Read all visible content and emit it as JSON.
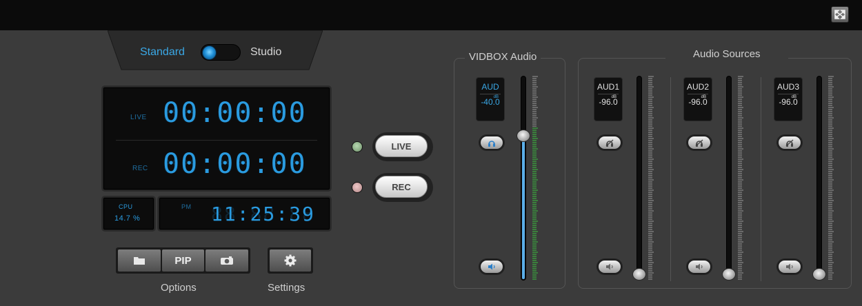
{
  "colors": {
    "accent": "#2a9be0",
    "meter_green": "#38c43c",
    "meter_tick": "#9a9a9a"
  },
  "mode": {
    "left_label": "Standard",
    "right_label": "Studio",
    "selected": "Standard"
  },
  "timers": {
    "live": {
      "label": "LIVE",
      "value": "00:00:00"
    },
    "rec": {
      "label": "REC",
      "value": "00:00:00"
    }
  },
  "cpu": {
    "label": "CPU",
    "value": "14.7 %"
  },
  "clock": {
    "ampm": "PM",
    "time": "11:25:39"
  },
  "options": {
    "buttons": [
      {
        "label": "",
        "icon": "folder-icon"
      },
      {
        "label": "PIP",
        "icon": ""
      },
      {
        "label": "",
        "icon": "camera-icon"
      }
    ],
    "caption": "Options"
  },
  "settings": {
    "icon": "gear-icon",
    "caption": "Settings"
  },
  "broadcast": {
    "live_label": "LIVE",
    "rec_label": "REC",
    "live_led": "#7fa87a",
    "rec_led": "#c99a9a"
  },
  "vidbox_audio": {
    "title": "VIDBOX Audio",
    "channel": {
      "name": "AUD",
      "unit": "dB",
      "value": "-40.0",
      "level_fraction": 0.72,
      "monitor_icon": "headphones-icon",
      "speaker_icon": "speaker-icon"
    }
  },
  "audio_sources": {
    "title": "Audio Sources",
    "channels": [
      {
        "name": "AUD1",
        "unit": "dB",
        "value": "-96.0",
        "level_fraction": 0.0,
        "monitor_icon": "headphones-muted-icon",
        "speaker_icon": "speaker-icon"
      },
      {
        "name": "AUD2",
        "unit": "dB",
        "value": "-96.0",
        "level_fraction": 0.0,
        "monitor_icon": "headphones-muted-icon",
        "speaker_icon": "speaker-icon"
      },
      {
        "name": "AUD3",
        "unit": "dB",
        "value": "-96.0",
        "level_fraction": 0.0,
        "monitor_icon": "headphones-muted-icon",
        "speaker_icon": "speaker-icon"
      }
    ]
  }
}
